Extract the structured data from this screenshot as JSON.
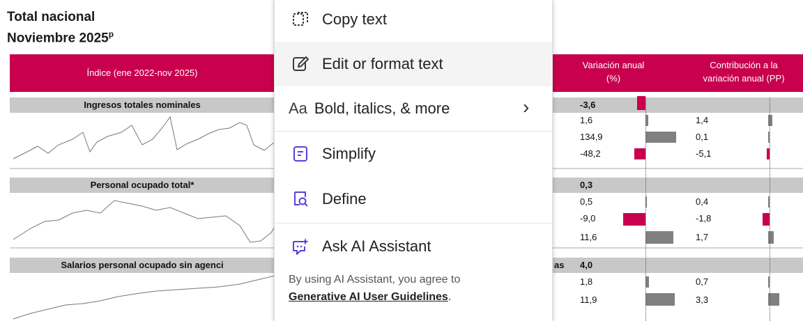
{
  "report": {
    "title_line1": "Total nacional",
    "title_line2": "Noviembre 2025",
    "title_sup": "p",
    "header": {
      "index_label": "Índice (ene 2022-nov 2025)",
      "var_label_1": "Variación anual",
      "var_label_2": "(%)",
      "contrib_label_1": "Contribución a la",
      "contrib_label_2": "variación anual (PP)"
    },
    "sections": [
      {
        "label": "Ingresos totales nominales",
        "total": "-3,6",
        "rows": [
          {
            "var": "1,6",
            "contrib": "1,4"
          },
          {
            "var": "134,9",
            "contrib": "0,1"
          },
          {
            "var": "-48,2",
            "contrib": "-5,1"
          }
        ]
      },
      {
        "label": "Personal ocupado total*",
        "total": "0,3",
        "rows": [
          {
            "var": "0,5",
            "contrib": "0,4"
          },
          {
            "var": "-9,0",
            "contrib": "-1,8"
          },
          {
            "var": "11,6",
            "contrib": "1,7"
          }
        ]
      },
      {
        "label": "Salarios personal ocupado sin agenci",
        "label_tail": "as",
        "total": "4,0",
        "rows": [
          {
            "var": "1,8",
            "contrib": "0,7"
          },
          {
            "var": "11,9",
            "contrib": "3,3"
          }
        ]
      }
    ]
  },
  "context_menu": {
    "items": [
      {
        "label": "Copy text",
        "icon": "copy-text-icon"
      },
      {
        "label": "Edit or format text",
        "icon": "edit-text-icon"
      },
      {
        "label": "Bold, italics, & more",
        "icon": "text-format-icon",
        "glyph": "Aa",
        "submenu_glyph": "›"
      },
      {
        "label": "Simplify",
        "icon": "simplify-icon"
      },
      {
        "label": "Define",
        "icon": "define-icon"
      },
      {
        "label": "Ask AI Assistant",
        "icon": "ai-assistant-icon"
      }
    ],
    "note_line1": "By using AI Assistant, you agree to",
    "note_link": "Generative AI User Guidelines",
    "note_end": "."
  },
  "colors": {
    "accent": "#c8004e",
    "bar_gray": "#808080",
    "section_gray": "#c8c8c8"
  }
}
